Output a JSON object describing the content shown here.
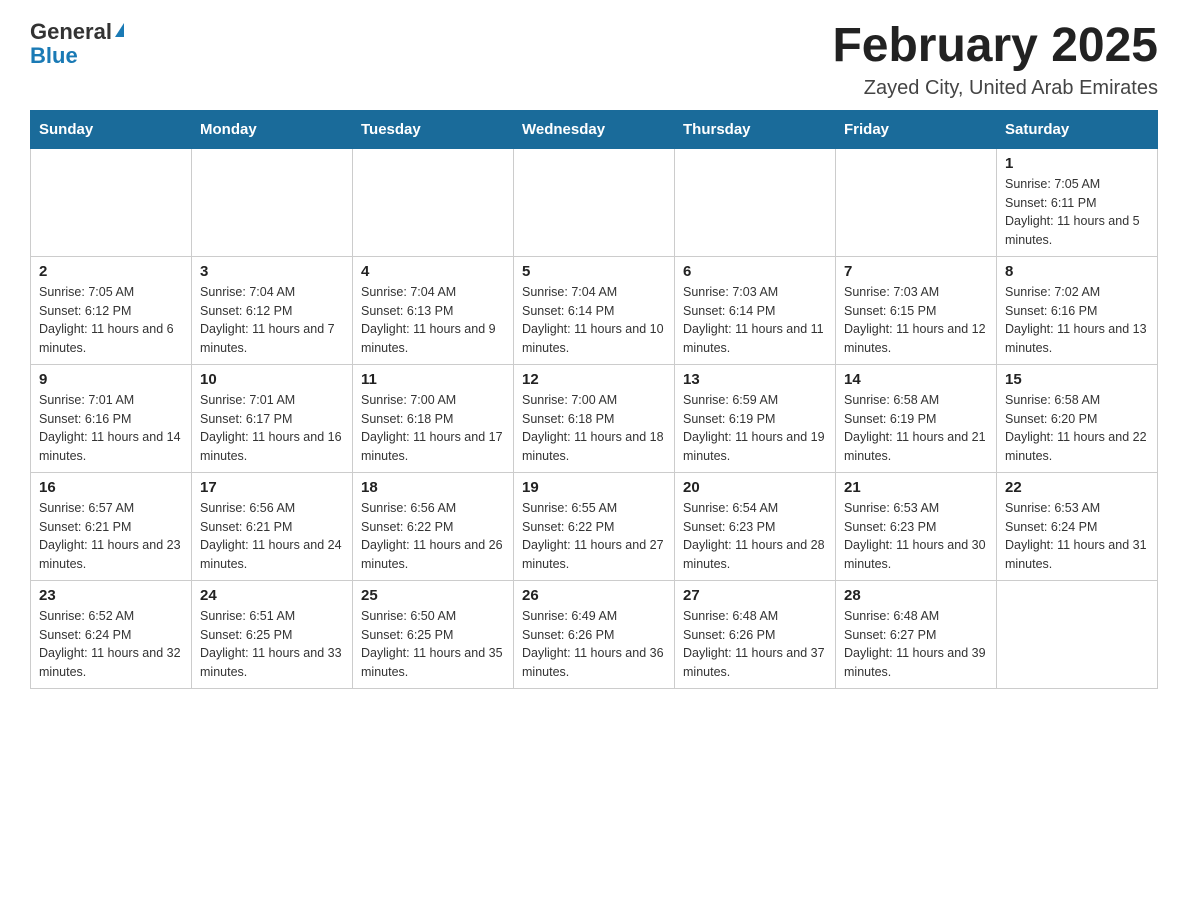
{
  "logo": {
    "general": "General",
    "blue": "Blue",
    "triangle": "▲"
  },
  "header": {
    "month_year": "February 2025",
    "location": "Zayed City, United Arab Emirates"
  },
  "days_of_week": [
    "Sunday",
    "Monday",
    "Tuesday",
    "Wednesday",
    "Thursday",
    "Friday",
    "Saturday"
  ],
  "weeks": [
    [
      {
        "day": "",
        "info": ""
      },
      {
        "day": "",
        "info": ""
      },
      {
        "day": "",
        "info": ""
      },
      {
        "day": "",
        "info": ""
      },
      {
        "day": "",
        "info": ""
      },
      {
        "day": "",
        "info": ""
      },
      {
        "day": "1",
        "info": "Sunrise: 7:05 AM\nSunset: 6:11 PM\nDaylight: 11 hours and 5 minutes."
      }
    ],
    [
      {
        "day": "2",
        "info": "Sunrise: 7:05 AM\nSunset: 6:12 PM\nDaylight: 11 hours and 6 minutes."
      },
      {
        "day": "3",
        "info": "Sunrise: 7:04 AM\nSunset: 6:12 PM\nDaylight: 11 hours and 7 minutes."
      },
      {
        "day": "4",
        "info": "Sunrise: 7:04 AM\nSunset: 6:13 PM\nDaylight: 11 hours and 9 minutes."
      },
      {
        "day": "5",
        "info": "Sunrise: 7:04 AM\nSunset: 6:14 PM\nDaylight: 11 hours and 10 minutes."
      },
      {
        "day": "6",
        "info": "Sunrise: 7:03 AM\nSunset: 6:14 PM\nDaylight: 11 hours and 11 minutes."
      },
      {
        "day": "7",
        "info": "Sunrise: 7:03 AM\nSunset: 6:15 PM\nDaylight: 11 hours and 12 minutes."
      },
      {
        "day": "8",
        "info": "Sunrise: 7:02 AM\nSunset: 6:16 PM\nDaylight: 11 hours and 13 minutes."
      }
    ],
    [
      {
        "day": "9",
        "info": "Sunrise: 7:01 AM\nSunset: 6:16 PM\nDaylight: 11 hours and 14 minutes."
      },
      {
        "day": "10",
        "info": "Sunrise: 7:01 AM\nSunset: 6:17 PM\nDaylight: 11 hours and 16 minutes."
      },
      {
        "day": "11",
        "info": "Sunrise: 7:00 AM\nSunset: 6:18 PM\nDaylight: 11 hours and 17 minutes."
      },
      {
        "day": "12",
        "info": "Sunrise: 7:00 AM\nSunset: 6:18 PM\nDaylight: 11 hours and 18 minutes."
      },
      {
        "day": "13",
        "info": "Sunrise: 6:59 AM\nSunset: 6:19 PM\nDaylight: 11 hours and 19 minutes."
      },
      {
        "day": "14",
        "info": "Sunrise: 6:58 AM\nSunset: 6:19 PM\nDaylight: 11 hours and 21 minutes."
      },
      {
        "day": "15",
        "info": "Sunrise: 6:58 AM\nSunset: 6:20 PM\nDaylight: 11 hours and 22 minutes."
      }
    ],
    [
      {
        "day": "16",
        "info": "Sunrise: 6:57 AM\nSunset: 6:21 PM\nDaylight: 11 hours and 23 minutes."
      },
      {
        "day": "17",
        "info": "Sunrise: 6:56 AM\nSunset: 6:21 PM\nDaylight: 11 hours and 24 minutes."
      },
      {
        "day": "18",
        "info": "Sunrise: 6:56 AM\nSunset: 6:22 PM\nDaylight: 11 hours and 26 minutes."
      },
      {
        "day": "19",
        "info": "Sunrise: 6:55 AM\nSunset: 6:22 PM\nDaylight: 11 hours and 27 minutes."
      },
      {
        "day": "20",
        "info": "Sunrise: 6:54 AM\nSunset: 6:23 PM\nDaylight: 11 hours and 28 minutes."
      },
      {
        "day": "21",
        "info": "Sunrise: 6:53 AM\nSunset: 6:23 PM\nDaylight: 11 hours and 30 minutes."
      },
      {
        "day": "22",
        "info": "Sunrise: 6:53 AM\nSunset: 6:24 PM\nDaylight: 11 hours and 31 minutes."
      }
    ],
    [
      {
        "day": "23",
        "info": "Sunrise: 6:52 AM\nSunset: 6:24 PM\nDaylight: 11 hours and 32 minutes."
      },
      {
        "day": "24",
        "info": "Sunrise: 6:51 AM\nSunset: 6:25 PM\nDaylight: 11 hours and 33 minutes."
      },
      {
        "day": "25",
        "info": "Sunrise: 6:50 AM\nSunset: 6:25 PM\nDaylight: 11 hours and 35 minutes."
      },
      {
        "day": "26",
        "info": "Sunrise: 6:49 AM\nSunset: 6:26 PM\nDaylight: 11 hours and 36 minutes."
      },
      {
        "day": "27",
        "info": "Sunrise: 6:48 AM\nSunset: 6:26 PM\nDaylight: 11 hours and 37 minutes."
      },
      {
        "day": "28",
        "info": "Sunrise: 6:48 AM\nSunset: 6:27 PM\nDaylight: 11 hours and 39 minutes."
      },
      {
        "day": "",
        "info": ""
      }
    ]
  ]
}
